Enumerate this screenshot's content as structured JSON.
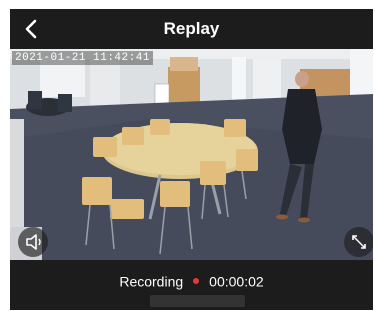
{
  "header": {
    "title": "Replay",
    "back_icon": "chevron-left-icon"
  },
  "video": {
    "timestamp": "2021-01-21 11:42:41",
    "mute_icon": "speaker-icon",
    "fullscreen_icon": "expand-icon"
  },
  "recording": {
    "label": "Recording",
    "indicator_color": "#e53935",
    "duration": "00:00:02"
  },
  "colors": {
    "background": "#1c1c1c",
    "text": "#ffffff"
  }
}
